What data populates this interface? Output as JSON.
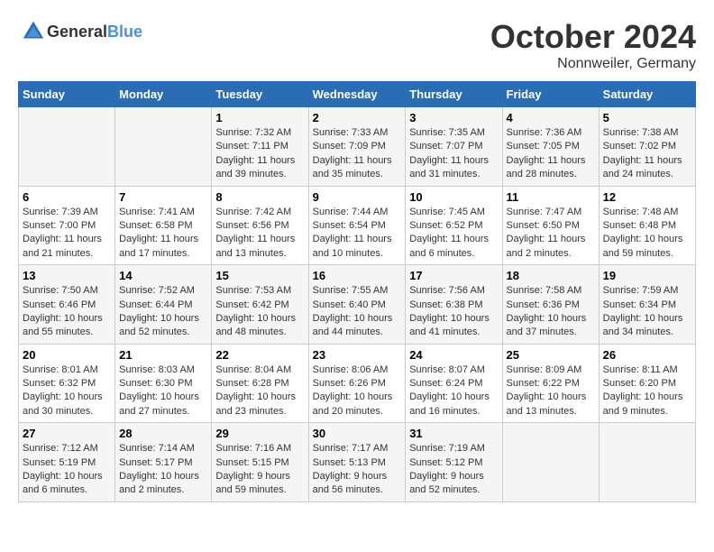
{
  "header": {
    "logo_general": "General",
    "logo_blue": "Blue",
    "month": "October 2024",
    "location": "Nonnweiler, Germany"
  },
  "weekdays": [
    "Sunday",
    "Monday",
    "Tuesday",
    "Wednesday",
    "Thursday",
    "Friday",
    "Saturday"
  ],
  "weeks": [
    [
      {
        "day": "",
        "info": ""
      },
      {
        "day": "",
        "info": ""
      },
      {
        "day": "1",
        "info": "Sunrise: 7:32 AM\nSunset: 7:11 PM\nDaylight: 11 hours and 39 minutes."
      },
      {
        "day": "2",
        "info": "Sunrise: 7:33 AM\nSunset: 7:09 PM\nDaylight: 11 hours and 35 minutes."
      },
      {
        "day": "3",
        "info": "Sunrise: 7:35 AM\nSunset: 7:07 PM\nDaylight: 11 hours and 31 minutes."
      },
      {
        "day": "4",
        "info": "Sunrise: 7:36 AM\nSunset: 7:05 PM\nDaylight: 11 hours and 28 minutes."
      },
      {
        "day": "5",
        "info": "Sunrise: 7:38 AM\nSunset: 7:02 PM\nDaylight: 11 hours and 24 minutes."
      }
    ],
    [
      {
        "day": "6",
        "info": "Sunrise: 7:39 AM\nSunset: 7:00 PM\nDaylight: 11 hours and 21 minutes."
      },
      {
        "day": "7",
        "info": "Sunrise: 7:41 AM\nSunset: 6:58 PM\nDaylight: 11 hours and 17 minutes."
      },
      {
        "day": "8",
        "info": "Sunrise: 7:42 AM\nSunset: 6:56 PM\nDaylight: 11 hours and 13 minutes."
      },
      {
        "day": "9",
        "info": "Sunrise: 7:44 AM\nSunset: 6:54 PM\nDaylight: 11 hours and 10 minutes."
      },
      {
        "day": "10",
        "info": "Sunrise: 7:45 AM\nSunset: 6:52 PM\nDaylight: 11 hours and 6 minutes."
      },
      {
        "day": "11",
        "info": "Sunrise: 7:47 AM\nSunset: 6:50 PM\nDaylight: 11 hours and 2 minutes."
      },
      {
        "day": "12",
        "info": "Sunrise: 7:48 AM\nSunset: 6:48 PM\nDaylight: 10 hours and 59 minutes."
      }
    ],
    [
      {
        "day": "13",
        "info": "Sunrise: 7:50 AM\nSunset: 6:46 PM\nDaylight: 10 hours and 55 minutes."
      },
      {
        "day": "14",
        "info": "Sunrise: 7:52 AM\nSunset: 6:44 PM\nDaylight: 10 hours and 52 minutes."
      },
      {
        "day": "15",
        "info": "Sunrise: 7:53 AM\nSunset: 6:42 PM\nDaylight: 10 hours and 48 minutes."
      },
      {
        "day": "16",
        "info": "Sunrise: 7:55 AM\nSunset: 6:40 PM\nDaylight: 10 hours and 44 minutes."
      },
      {
        "day": "17",
        "info": "Sunrise: 7:56 AM\nSunset: 6:38 PM\nDaylight: 10 hours and 41 minutes."
      },
      {
        "day": "18",
        "info": "Sunrise: 7:58 AM\nSunset: 6:36 PM\nDaylight: 10 hours and 37 minutes."
      },
      {
        "day": "19",
        "info": "Sunrise: 7:59 AM\nSunset: 6:34 PM\nDaylight: 10 hours and 34 minutes."
      }
    ],
    [
      {
        "day": "20",
        "info": "Sunrise: 8:01 AM\nSunset: 6:32 PM\nDaylight: 10 hours and 30 minutes."
      },
      {
        "day": "21",
        "info": "Sunrise: 8:03 AM\nSunset: 6:30 PM\nDaylight: 10 hours and 27 minutes."
      },
      {
        "day": "22",
        "info": "Sunrise: 8:04 AM\nSunset: 6:28 PM\nDaylight: 10 hours and 23 minutes."
      },
      {
        "day": "23",
        "info": "Sunrise: 8:06 AM\nSunset: 6:26 PM\nDaylight: 10 hours and 20 minutes."
      },
      {
        "day": "24",
        "info": "Sunrise: 8:07 AM\nSunset: 6:24 PM\nDaylight: 10 hours and 16 minutes."
      },
      {
        "day": "25",
        "info": "Sunrise: 8:09 AM\nSunset: 6:22 PM\nDaylight: 10 hours and 13 minutes."
      },
      {
        "day": "26",
        "info": "Sunrise: 8:11 AM\nSunset: 6:20 PM\nDaylight: 10 hours and 9 minutes."
      }
    ],
    [
      {
        "day": "27",
        "info": "Sunrise: 7:12 AM\nSunset: 5:19 PM\nDaylight: 10 hours and 6 minutes."
      },
      {
        "day": "28",
        "info": "Sunrise: 7:14 AM\nSunset: 5:17 PM\nDaylight: 10 hours and 2 minutes."
      },
      {
        "day": "29",
        "info": "Sunrise: 7:16 AM\nSunset: 5:15 PM\nDaylight: 9 hours and 59 minutes."
      },
      {
        "day": "30",
        "info": "Sunrise: 7:17 AM\nSunset: 5:13 PM\nDaylight: 9 hours and 56 minutes."
      },
      {
        "day": "31",
        "info": "Sunrise: 7:19 AM\nSunset: 5:12 PM\nDaylight: 9 hours and 52 minutes."
      },
      {
        "day": "",
        "info": ""
      },
      {
        "day": "",
        "info": ""
      }
    ]
  ]
}
